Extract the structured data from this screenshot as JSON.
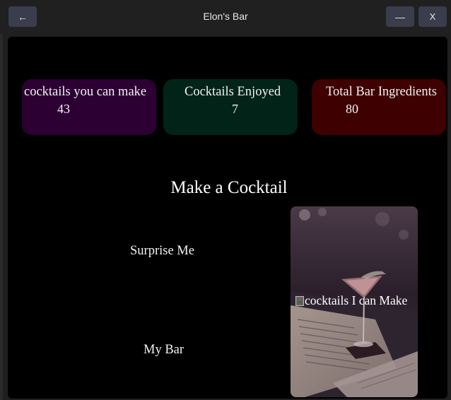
{
  "window": {
    "title": "Elon's Bar",
    "back_label": "←",
    "minimize_label": "—",
    "close_label": "X"
  },
  "stats": {
    "can_make": {
      "label": "cocktails you can make",
      "value": "43",
      "color": "#2c0033"
    },
    "enjoyed": {
      "label": "Cocktails Enjoyed",
      "value": "7",
      "color": "#012318"
    },
    "total_ingredients": {
      "label": "Total Bar Ingredients",
      "value": "80",
      "color": "#3e0000"
    }
  },
  "make": {
    "heading": "Make a Cocktail",
    "surprise_label": "Surprise Me",
    "mybar_label": "My Bar",
    "tile_label": "cocktails I can Make"
  }
}
